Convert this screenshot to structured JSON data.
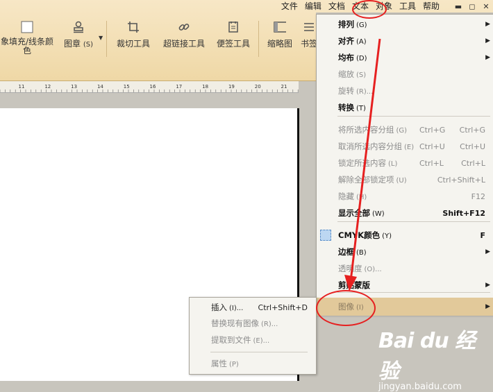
{
  "menubar": {
    "items": [
      "文件",
      "编辑",
      "文档",
      "文本",
      "对象",
      "工具",
      "帮助"
    ],
    "active": "对象"
  },
  "toolbar": {
    "fill_stroke_label": "象填充/线条颜\n色",
    "stamp_label": "图章",
    "stamp_shortcut": "(S)",
    "crop_label": "裁切工具",
    "hyperlink_label": "超链接工具",
    "note_label": "便签工具",
    "thumbnail_label": "缩略图",
    "bookmark_label": "书签"
  },
  "ruler": {
    "ticks": [
      "11",
      "12",
      "13",
      "14",
      "15",
      "16",
      "17",
      "18",
      "19",
      "20",
      "21"
    ]
  },
  "context_menu": {
    "items": [
      {
        "label": "排列",
        "key": "(G)",
        "enabled": true,
        "submenu": true
      },
      {
        "label": "对齐",
        "key": "(A)",
        "enabled": true,
        "submenu": true
      },
      {
        "label": "均布",
        "key": "(D)",
        "enabled": true,
        "submenu": true
      },
      {
        "label": "缩放",
        "key": "(S)",
        "enabled": false
      },
      {
        "label": "旋转",
        "key": "(R)...",
        "enabled": false
      },
      {
        "label": "转换",
        "key": "(T)",
        "enabled": true
      },
      {
        "label": "将所选内容分组",
        "key": "(G)",
        "enabled": false,
        "shortcut1": "Ctrl+G",
        "shortcut2": "Ctrl+G"
      },
      {
        "label": "取消所选内容分组",
        "key": "(E)",
        "enabled": false,
        "shortcut1": "Ctrl+U",
        "shortcut2": "Ctrl+U"
      },
      {
        "label": "锁定所选内容",
        "key": "(L)",
        "enabled": false,
        "shortcut1": "Ctrl+L",
        "shortcut2": "Ctrl+L"
      },
      {
        "label": "解除全部锁定项",
        "key": "(U)",
        "enabled": false,
        "shortcut2": "Ctrl+Shift+L"
      },
      {
        "label": "隐藏",
        "key": "(H)",
        "enabled": false,
        "shortcut2": "F12"
      },
      {
        "label": "显示全部",
        "key": "(W)",
        "enabled": true,
        "shortcut2": "Shift+F12"
      },
      {
        "label": "CMYK颜色",
        "key": "(Y)",
        "enabled": true,
        "shortcut2": "F"
      },
      {
        "label": "边框",
        "key": "(B)",
        "enabled": true,
        "submenu": true
      },
      {
        "label": "透明度",
        "key": "(O)...",
        "enabled": false
      },
      {
        "label": "剪贴蒙版",
        "key": "",
        "enabled": true,
        "submenu": true
      },
      {
        "label": "图像",
        "key": "(I)",
        "enabled": false,
        "submenu": true,
        "highlighted": true
      }
    ]
  },
  "image_submenu": {
    "items": [
      {
        "label": "插入",
        "key": "(I)...",
        "enabled": true,
        "shortcut": "Ctrl+Shift+D"
      },
      {
        "label": "替换现有图像",
        "key": "(R)...",
        "enabled": false
      },
      {
        "label": "提取到文件",
        "key": "(E)...",
        "enabled": false
      },
      {
        "label": "属性",
        "key": "(P)",
        "enabled": false
      }
    ]
  },
  "watermark": {
    "logo": "Bai du 经验",
    "url": "jingyan.baidu.com"
  },
  "colors": {
    "ribbon": "#efd8a6",
    "menu_bg": "#f5f4ef",
    "highlight": "#e2c99a",
    "annotation_red": "#e62020"
  }
}
